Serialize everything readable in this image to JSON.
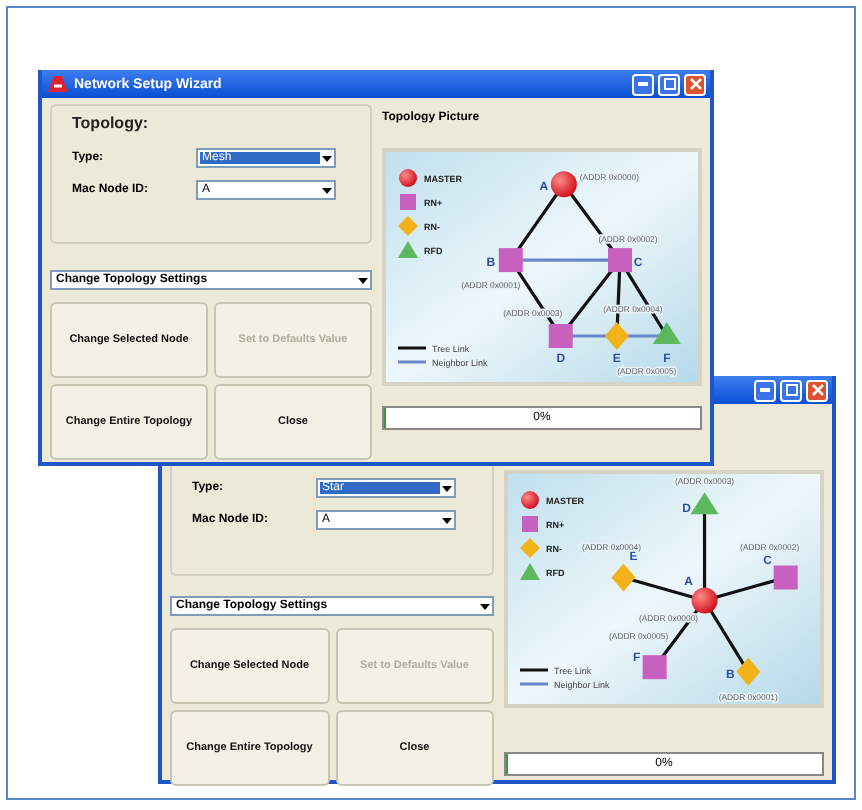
{
  "windows": [
    {
      "title": "Network Setup Wizard",
      "group_title": "Topology:",
      "fields": [
        {
          "label": "Type:",
          "value": "Mesh",
          "highlighted": true
        },
        {
          "label": "Mac Node ID:",
          "value": "A",
          "highlighted": false
        }
      ],
      "action_select": "Change Topology Settings",
      "buttons": [
        {
          "label": "Change Selected Node",
          "disabled": false
        },
        {
          "label": "Set to Defaults Value",
          "disabled": true
        },
        {
          "label": "Change Entire Topology",
          "disabled": false
        },
        {
          "label": "Close",
          "disabled": false
        }
      ],
      "picture_title": "Topology Picture",
      "picture": {
        "kind": "mesh",
        "legend": [
          {
            "kind": "master",
            "label": "MASTER"
          },
          {
            "kind": "rn_plus",
            "label": "RN+"
          },
          {
            "kind": "rn_minus",
            "label": "RN-"
          },
          {
            "kind": "rfd",
            "label": "RFD"
          }
        ],
        "link_legend": [
          {
            "kind": "tree",
            "label": "Tree Link"
          },
          {
            "kind": "neighbor",
            "label": "Neighbor Link"
          }
        ],
        "nodes": [
          {
            "kind": "master",
            "letter": "A",
            "address": "(ADDR 0x0000)"
          },
          {
            "kind": "rn_plus",
            "letter": "B",
            "address": "(ADDR 0x0001)"
          },
          {
            "kind": "rn_plus",
            "letter": "C",
            "address": "(ADDR 0x0002)"
          },
          {
            "kind": "rn_plus",
            "letter": "D",
            "address": "(ADDR 0x0003)"
          },
          {
            "kind": "rn_minus",
            "letter": "E",
            "address": "(ADDR 0x0004)"
          },
          {
            "kind": "rfd",
            "letter": "F",
            "address": "(ADDR 0x0005)"
          }
        ]
      },
      "progress": {
        "level": 0,
        "text": "0%"
      }
    },
    {
      "fields": [
        {
          "label": "Type:",
          "value": "Star",
          "highlighted": true
        },
        {
          "label": "Mac Node ID:",
          "value": "A",
          "highlighted": false
        }
      ],
      "action_select": "Change Topology Settings",
      "buttons": [
        {
          "label": "Change Selected Node",
          "disabled": false
        },
        {
          "label": "Set to Defaults Value",
          "disabled": true
        },
        {
          "label": "Change Entire Topology",
          "disabled": false
        },
        {
          "label": "Close",
          "disabled": false
        }
      ],
      "picture": {
        "kind": "star",
        "legend": [
          {
            "kind": "master",
            "label": "MASTER"
          },
          {
            "kind": "rn_plus",
            "label": "RN+"
          },
          {
            "kind": "rn_minus",
            "label": "RN-"
          },
          {
            "kind": "rfd",
            "label": "RFD"
          }
        ],
        "link_legend": [
          {
            "kind": "tree",
            "label": "Tree Link"
          },
          {
            "kind": "neighbor",
            "label": "Neighbor Link"
          }
        ],
        "nodes": [
          {
            "kind": "master",
            "letter": "A",
            "address": "(ADDR 0x0000)"
          },
          {
            "kind": "rn_minus",
            "letter": "B",
            "address": "(ADDR 0x0001)"
          },
          {
            "kind": "rn_plus",
            "letter": "C",
            "address": "(ADDR 0x0002)"
          },
          {
            "kind": "rfd",
            "letter": "D",
            "address": "(ADDR 0x0003)"
          },
          {
            "kind": "rn_minus",
            "letter": "E",
            "address": "(ADDR 0x0004)"
          },
          {
            "kind": "rn_plus",
            "letter": "F",
            "address": "(ADDR 0x0005)"
          }
        ]
      },
      "progress": {
        "level": 0,
        "text": "0%"
      }
    }
  ]
}
